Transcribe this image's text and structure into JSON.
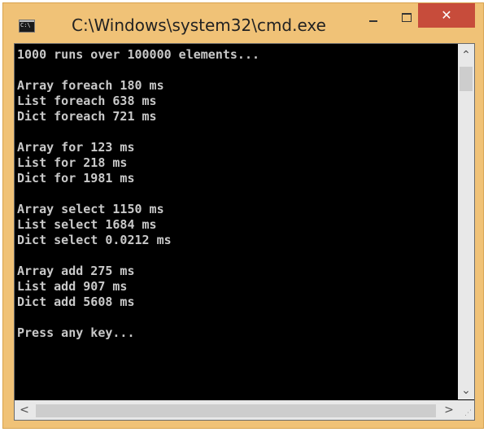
{
  "window": {
    "title": "C:\\Windows\\system32\\cmd.exe",
    "icon_name": "cmd-app-icon",
    "icon_text": "C:\\",
    "controls": {
      "minimize_icon": "minimize-icon",
      "maximize_icon": "maximize-icon",
      "close_icon": "close-icon",
      "close_glyph": "✕"
    },
    "colors": {
      "frame": "#f0c277",
      "close_button": "#c74c3b",
      "console_background": "#000000",
      "console_text": "#c9c9c9"
    }
  },
  "console": {
    "lines": [
      "1000 runs over 100000 elements...",
      "",
      "Array foreach 180 ms",
      "List foreach 638 ms",
      "Dict foreach 721 ms",
      "",
      "Array for 123 ms",
      "List for 218 ms",
      "Dict for 1981 ms",
      "",
      "Array select 1150 ms",
      "List select 1684 ms",
      "Dict select 0.0212 ms",
      "",
      "Array add 275 ms",
      "List add 907 ms",
      "Dict add 5608 ms",
      "",
      "Press any key..."
    ]
  },
  "scrollbars": {
    "up_glyph": "⌃",
    "down_glyph": "⌄",
    "left_glyph": "<",
    "right_glyph": ">",
    "grip_glyph": "⋰"
  }
}
